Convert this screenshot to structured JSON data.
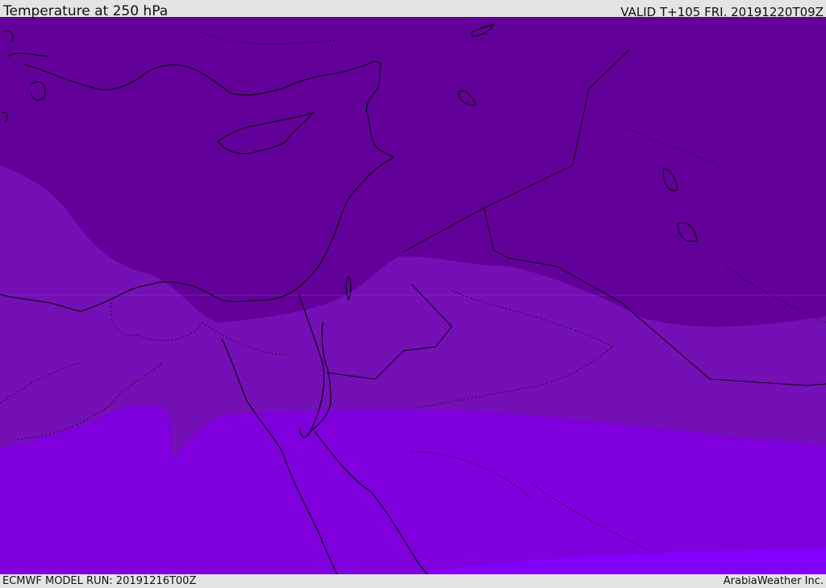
{
  "header": {
    "title": "Temperature at 250 hPa",
    "valid": "VALID T+105 FRI. 20191220T09Z"
  },
  "footer": {
    "model_run": "ECMWF MODEL RUN: 20191216T00Z",
    "credit": "ArabiaWeather Inc."
  },
  "map": {
    "field": "temperature",
    "level": "250 hPa",
    "colors": {
      "band_coldest": "#63009a",
      "band_cold": "#7510b6",
      "band_mid": "#7f00dd",
      "band_warm": "#8300ff",
      "coastline": "#000000"
    }
  }
}
